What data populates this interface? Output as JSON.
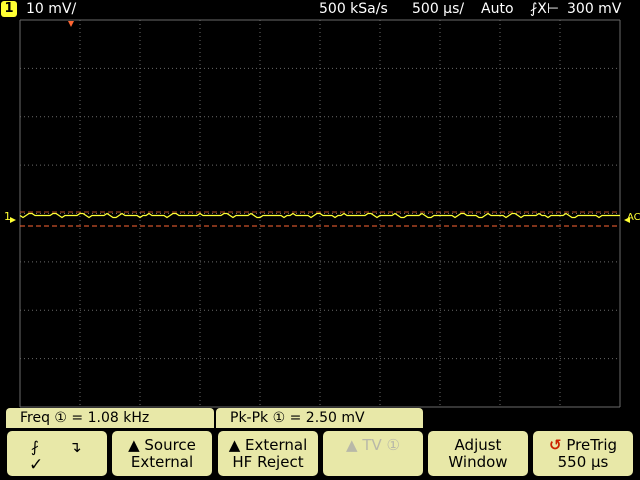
{
  "topbar": {
    "channel_number": "1",
    "vertical_scale": "10 mV/",
    "sample_rate": "500 kSa/s",
    "time_scale": "500 µs/",
    "trigger_mode": "Auto",
    "trigger_symbol": "⨏X⊢",
    "trigger_level": "300 mV"
  },
  "markers": {
    "channel_marker": "1",
    "coupling_label": "AC"
  },
  "measurements": {
    "freq": "Freq ① =  1.08 kHz",
    "pkpk": "Pk-Pk ① =  2.50 mV"
  },
  "softkeys": {
    "edge": {
      "rising_icon": "rising-edge",
      "falling_icon": "falling-edge",
      "check": "✓"
    },
    "source": {
      "line1": "▲ Source",
      "line2": "External"
    },
    "external": {
      "line1": "▲ External",
      "line2": "HF Reject"
    },
    "tv": {
      "line1": "▲ TV ①"
    },
    "adjust": {
      "line1": "Adjust",
      "line2": "Window"
    },
    "pretrig": {
      "line1": "PreTrig",
      "line2": "550 µs"
    }
  },
  "colors": {
    "trace": "#ffff33",
    "trigger_marker": "#ff6633",
    "grid": "#6a6a6a",
    "softkey_bg": "#e8e8a8"
  }
}
